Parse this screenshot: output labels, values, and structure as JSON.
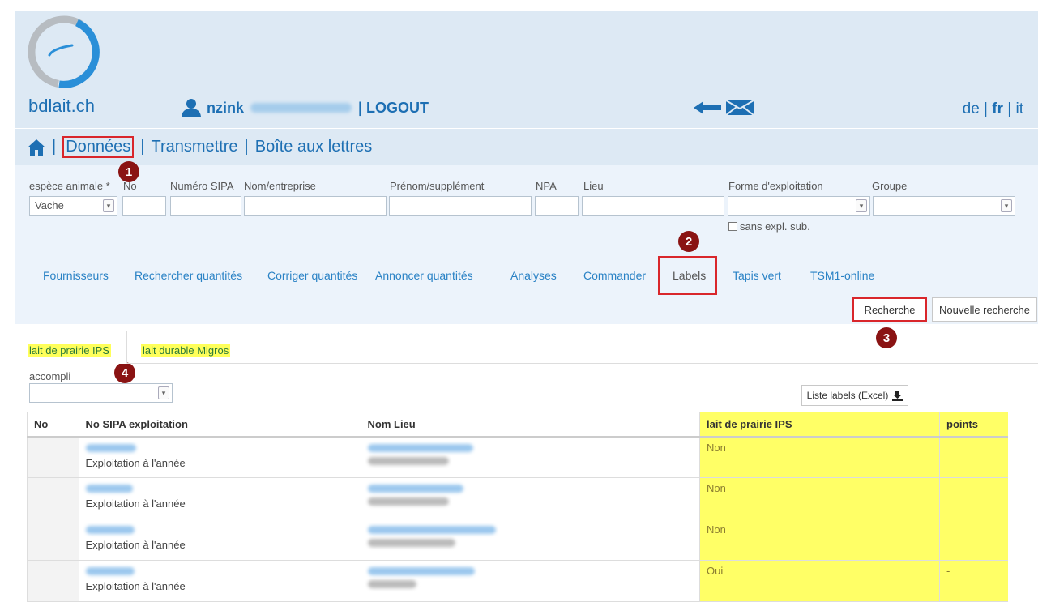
{
  "header": {
    "brand": "bdlait.ch",
    "username": "nzink",
    "logout": "| LOGOUT",
    "lang": {
      "de": "de",
      "fr": "fr",
      "it": "it",
      "sep": "|"
    }
  },
  "nav": {
    "items": [
      "Données",
      "Transmettre",
      "Boîte aux lettres"
    ],
    "sep": "|"
  },
  "filters": {
    "espece_label": "espèce animale *",
    "espece_value": "Vache",
    "no_label": "No",
    "sipa_label": "Numéro SIPA",
    "nom_label": "Nom/entreprise",
    "prenom_label": "Prénom/supplément",
    "npa_label": "NPA",
    "lieu_label": "Lieu",
    "forme_label": "Forme d'exploitation",
    "groupe_label": "Groupe",
    "sans_expl": "sans expl. sub."
  },
  "tabs": [
    "Fournisseurs",
    "Rechercher quantités",
    "Corriger quantités",
    "Annoncer quantités",
    "Analyses",
    "Commander",
    "Labels",
    "Tapis vert",
    "TSM1-online"
  ],
  "buttons": {
    "recherche": "Recherche",
    "nouvelle": "Nouvelle recherche",
    "excel": "Liste labels (Excel)"
  },
  "badges": [
    "1",
    "2",
    "3",
    "4"
  ],
  "subtabs": [
    "lait de prairie IPS",
    "lait durable Migros"
  ],
  "accompli_label": "accompli",
  "table": {
    "headers": [
      "No",
      "No SIPA exploitation",
      "Nom Lieu",
      "lait de prairie IPS",
      "points"
    ],
    "rows": [
      {
        "type": "Exploitation à l'année",
        "ips": "Non",
        "points": ""
      },
      {
        "type": "Exploitation à l'année",
        "ips": "Non",
        "points": ""
      },
      {
        "type": "Exploitation à l'année",
        "ips": "Non",
        "points": ""
      },
      {
        "type": "Exploitation à l'année",
        "ips": "Oui",
        "points": "-"
      }
    ]
  },
  "colors": {
    "accent": "#1d6fb3",
    "highlight": "#d9262b",
    "badge": "#8a1313",
    "yellow": "#ffff66"
  }
}
